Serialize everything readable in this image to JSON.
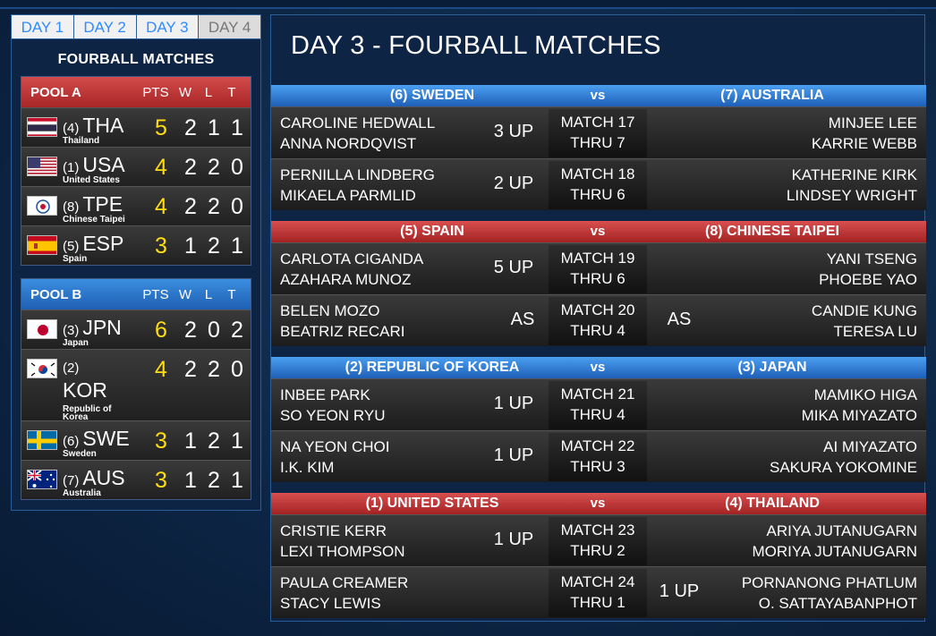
{
  "day_tabs": [
    "DAY 1",
    "DAY 2",
    "DAY 3",
    "DAY 4"
  ],
  "left_title": "FOURBALL MATCHES",
  "headers": {
    "pts": "PTS",
    "w": "W",
    "l": "L",
    "t": "T"
  },
  "pool_a": {
    "name": "POOL A",
    "teams": [
      {
        "seed": "(4)",
        "code": "THA",
        "name": "Thailand",
        "pts": "5",
        "w": "2",
        "l": "1",
        "t": "1",
        "flag": "flag-thailand-icon"
      },
      {
        "seed": "(1)",
        "code": "USA",
        "name": "United States",
        "pts": "4",
        "w": "2",
        "l": "2",
        "t": "0",
        "flag": "flag-usa-icon"
      },
      {
        "seed": "(8)",
        "code": "TPE",
        "name": "Chinese Taipei",
        "pts": "4",
        "w": "2",
        "l": "2",
        "t": "0",
        "flag": "flag-chinese-taipei-icon"
      },
      {
        "seed": "(5)",
        "code": "ESP",
        "name": "Spain",
        "pts": "3",
        "w": "1",
        "l": "2",
        "t": "1",
        "flag": "flag-spain-icon"
      }
    ]
  },
  "pool_b": {
    "name": "POOL B",
    "teams": [
      {
        "seed": "(3)",
        "code": "JPN",
        "name": "Japan",
        "pts": "6",
        "w": "2",
        "l": "0",
        "t": "2",
        "flag": "flag-japan-icon"
      },
      {
        "seed": "(2)",
        "code": "KOR",
        "name": "Republic of Korea",
        "pts": "4",
        "w": "2",
        "l": "2",
        "t": "0",
        "flag": "flag-korea-icon"
      },
      {
        "seed": "(6)",
        "code": "SWE",
        "name": "Sweden",
        "pts": "3",
        "w": "1",
        "l": "2",
        "t": "1",
        "flag": "flag-sweden-icon"
      },
      {
        "seed": "(7)",
        "code": "AUS",
        "name": "Australia",
        "pts": "3",
        "w": "1",
        "l": "2",
        "t": "1",
        "flag": "flag-australia-icon"
      }
    ]
  },
  "main_title": "DAY 3 - FOURBALL MATCHES",
  "vs": "vs",
  "groups": [
    {
      "left_team": "(6) SWEDEN",
      "right_team": "(7) AUSTRALIA",
      "color": "blue",
      "matches": [
        {
          "left_p1": "CAROLINE HEDWALL",
          "left_p2": "ANNA NORDQVIST",
          "score_left": "3 UP",
          "score_right": "",
          "match": "MATCH 17",
          "thru": "THRU 7",
          "right_p1": "MINJEE LEE",
          "right_p2": "KARRIE WEBB"
        },
        {
          "left_p1": "PERNILLA LINDBERG",
          "left_p2": "MIKAELA PARMLID",
          "score_left": "2 UP",
          "score_right": "",
          "match": "MATCH 18",
          "thru": "THRU 6",
          "right_p1": "KATHERINE KIRK",
          "right_p2": "LINDSEY WRIGHT"
        }
      ]
    },
    {
      "left_team": "(5) SPAIN",
      "right_team": "(8) CHINESE TAIPEI",
      "color": "red",
      "matches": [
        {
          "left_p1": "CARLOTA CIGANDA",
          "left_p2": "AZAHARA MUNOZ",
          "score_left": "5 UP",
          "score_right": "",
          "match": "MATCH 19",
          "thru": "THRU 6",
          "right_p1": "YANI TSENG",
          "right_p2": "PHOEBE YAO"
        },
        {
          "left_p1": "BELEN MOZO",
          "left_p2": "BEATRIZ RECARI",
          "score_left": "AS",
          "score_right": "AS",
          "match": "MATCH 20",
          "thru": "THRU 4",
          "right_p1": "CANDIE KUNG",
          "right_p2": "TERESA LU"
        }
      ]
    },
    {
      "left_team": "(2) REPUBLIC OF KOREA",
      "right_team": "(3) JAPAN",
      "color": "blue",
      "matches": [
        {
          "left_p1": "INBEE PARK",
          "left_p2": "SO YEON RYU",
          "score_left": "1 UP",
          "score_right": "",
          "match": "MATCH 21",
          "thru": "THRU 4",
          "right_p1": "MAMIKO HIGA",
          "right_p2": "MIKA MIYAZATO"
        },
        {
          "left_p1": "NA YEON CHOI",
          "left_p2": "I.K. KIM",
          "score_left": "1 UP",
          "score_right": "",
          "match": "MATCH 22",
          "thru": "THRU 3",
          "right_p1": "AI MIYAZATO",
          "right_p2": "SAKURA YOKOMINE"
        }
      ]
    },
    {
      "left_team": "(1) UNITED STATES",
      "right_team": "(4) THAILAND",
      "color": "red",
      "matches": [
        {
          "left_p1": "CRISTIE KERR",
          "left_p2": "LEXI THOMPSON",
          "score_left": "1 UP",
          "score_right": "",
          "match": "MATCH 23",
          "thru": "THRU 2",
          "right_p1": "ARIYA JUTANUGARN",
          "right_p2": "MORIYA JUTANUGARN"
        },
        {
          "left_p1": "PAULA CREAMER",
          "left_p2": "STACY LEWIS",
          "score_left": "",
          "score_right": "1 UP",
          "match": "MATCH 24",
          "thru": "THRU 1",
          "right_p1": "PORNANONG PHATLUM",
          "right_p2": "O. SATTAYABANPHOT"
        }
      ]
    }
  ]
}
